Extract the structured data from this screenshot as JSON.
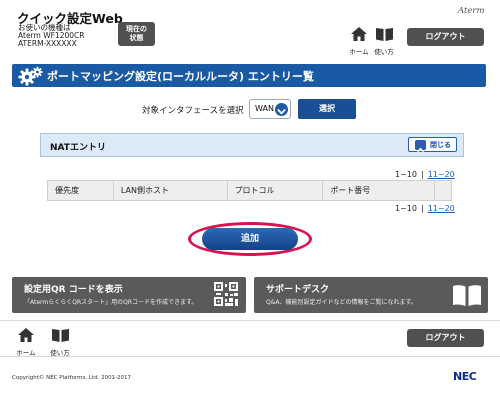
{
  "header": {
    "app_title": "クイック設定Web",
    "device_label": "お使いの機種は",
    "device_model": "Aterm WF1200CR",
    "device_id": "ATERM-XXXXXX",
    "status_button_line1": "現在の",
    "status_button_line2": "状態",
    "brand": "Aterm",
    "home_label": "ホーム",
    "help_label": "使い方",
    "logout_label": "ログアウト"
  },
  "page": {
    "title": "ポートマッピング設定(ローカルルータ) エントリー覧"
  },
  "interface": {
    "label": "対象インタフェースを選択",
    "selected_value": "WAN",
    "select_button": "選択"
  },
  "nat": {
    "section_title": "NATエントリ",
    "close_button": "閉じる",
    "pager": {
      "current": "1~10",
      "next": "11~20"
    },
    "columns": [
      "優先度",
      "LAN側ホスト",
      "プロトコル",
      "ポート番号"
    ]
  },
  "add_button": "追加",
  "cards": {
    "qr": {
      "title": "設定用QR コードを表示",
      "subtitle": "「AtermらくらくQRスタート」用のQRコードを作成できます。"
    },
    "support": {
      "title": "サポートデスク",
      "subtitle": "Q&A、機能別設定ガイドなどの情報をご覧になれます。"
    }
  },
  "footer": {
    "home_label": "ホーム",
    "help_label": "使い方",
    "logout_label": "ログアウト",
    "copyright": "Copyright© NEC Platforms, Ltd. 2001-2017",
    "brand": "NEC"
  },
  "colors": {
    "primary_blue": "#1a5aa5",
    "dark_button": "#505050",
    "highlight_ring": "#d8124f",
    "nat_bar": "#dce9f7",
    "link": "#1a5fb4"
  }
}
